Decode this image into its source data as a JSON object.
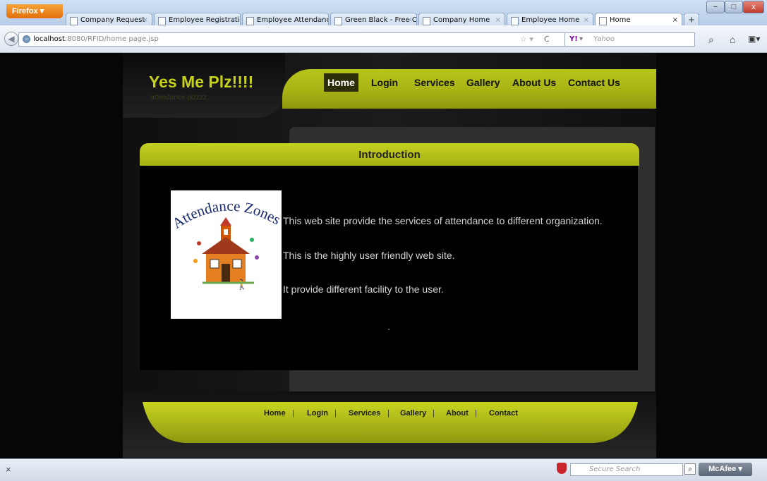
{
  "browser": {
    "menu_button": "Firefox",
    "tabs": [
      {
        "label": "Company Request"
      },
      {
        "label": "Employee Registrati..."
      },
      {
        "label": "Employee Attendance"
      },
      {
        "label": "Green Black - Free C..."
      },
      {
        "label": "Company Home"
      },
      {
        "label": "Employee Home"
      },
      {
        "label": "Home"
      }
    ],
    "new_tab": "+",
    "window_controls": [
      "−",
      "□",
      "x"
    ],
    "url_host": "localhost",
    "url_rest": ":8080/RFID/home page.jsp",
    "search_engine": "Y!",
    "search_placeholder": "Yahoo"
  },
  "site": {
    "title": "Yes Me Plz!!!!",
    "subtitle": "attendance plzzzz.",
    "nav": [
      "Home",
      "Login",
      "Services",
      "Gallery",
      "About Us",
      "Contact Us"
    ],
    "active_nav": "Home",
    "section_title": "Introduction",
    "image_caption": "Attendance Zones",
    "paragraphs": [
      "This web site provide the services of attendance to different organization.",
      "This is the highly user friendly web site.",
      "It provide different facility to the user."
    ],
    "footer_links": [
      "Home",
      "Login",
      "Services",
      "Gallery",
      "About",
      "Contact"
    ]
  },
  "statusbar": {
    "close": "×",
    "secure_search_placeholder": "Secure Search",
    "mcafee_label": "McAfee"
  },
  "colors": {
    "accent_green": "#b7c41a",
    "title_green": "#c7d21a",
    "background": "#000000"
  }
}
